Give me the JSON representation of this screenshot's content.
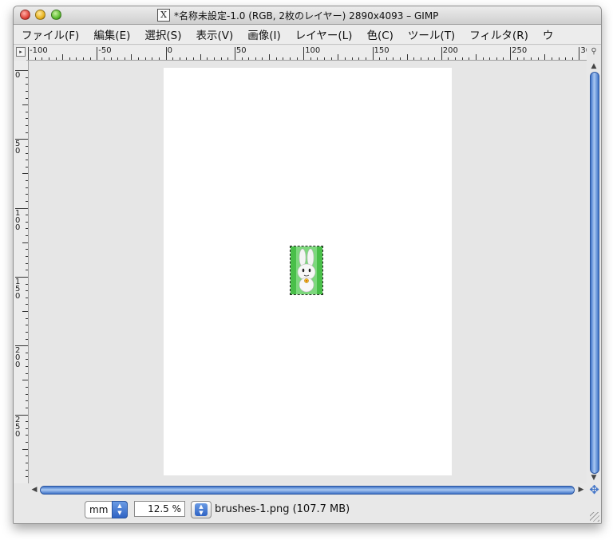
{
  "window": {
    "title": "*名称未設定-1.0 (RGB, 2枚のレイヤー) 2890x4093 – GIMP",
    "app_icon": "x11-icon"
  },
  "menubar": {
    "items": [
      {
        "label": "ファイル(F)"
      },
      {
        "label": "編集(E)"
      },
      {
        "label": "選択(S)"
      },
      {
        "label": "表示(V)"
      },
      {
        "label": "画像(I)"
      },
      {
        "label": "レイヤー(L)"
      },
      {
        "label": "色(C)"
      },
      {
        "label": "ツール(T)"
      },
      {
        "label": "フィルタ(R)"
      },
      {
        "label": "ウ"
      }
    ]
  },
  "rulers": {
    "horizontal_labels": [
      "-100",
      "-50",
      "0",
      "50",
      "100",
      "150",
      "200",
      "250",
      "30"
    ],
    "vertical_labels": [
      "0",
      "50",
      "100",
      "150",
      "200",
      "250"
    ]
  },
  "statusbar": {
    "unit": "mm",
    "zoom": "12.5 %",
    "file_info": "brushes-1.png (107.7 MB)"
  },
  "colors": {
    "layer_green": "#49bf49",
    "scroll_blue": "#3f73c8"
  }
}
